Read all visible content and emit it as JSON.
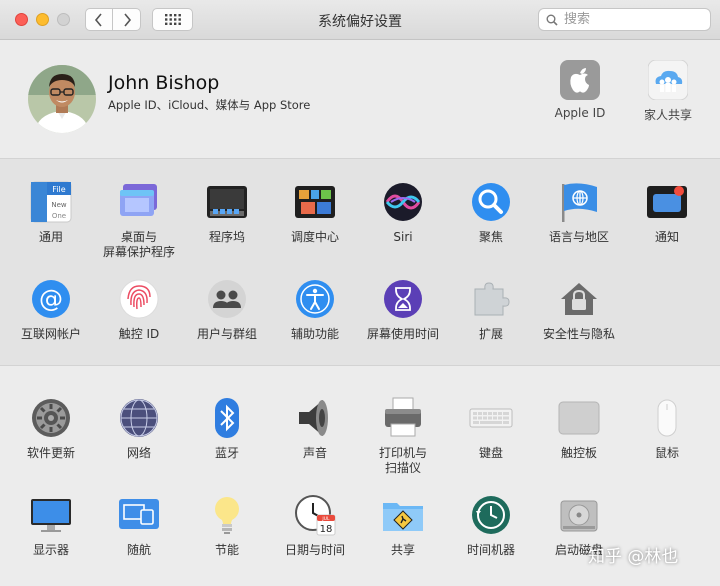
{
  "window": {
    "title": "系统偏好设置"
  },
  "search": {
    "placeholder": "搜索"
  },
  "account": {
    "name": "John Bishop",
    "subtitle": "Apple ID、iCloud、媒体与 App Store",
    "apple_id_label": "Apple ID",
    "family_label": "家人共享"
  },
  "section1": {
    "row1": [
      "通用",
      "桌面与\n屏幕保护程序",
      "程序坞",
      "调度中心",
      "Siri",
      "聚焦",
      "语言与地区",
      "通知"
    ],
    "row2": [
      "互联网帐户",
      "触控 ID",
      "用户与群组",
      "辅助功能",
      "屏幕使用时间",
      "扩展",
      "安全性与隐私"
    ]
  },
  "section2": {
    "row1": [
      "软件更新",
      "网络",
      "蓝牙",
      "声音",
      "打印机与\n扫描仪",
      "键盘",
      "触控板",
      "鼠标"
    ],
    "row2": [
      "显示器",
      "随航",
      "节能",
      "日期与时间",
      "共享",
      "时间机器",
      "启动磁盘"
    ]
  },
  "date_icon": {
    "month": "JUL",
    "day": "18"
  },
  "general_icon": {
    "line1": "File",
    "line2": "New",
    "line3": "One"
  },
  "watermark": "知乎 @林也",
  "colors": {
    "red": "#fc5f57",
    "yellow": "#fdbc2e",
    "accent": "#1d7ff2"
  }
}
